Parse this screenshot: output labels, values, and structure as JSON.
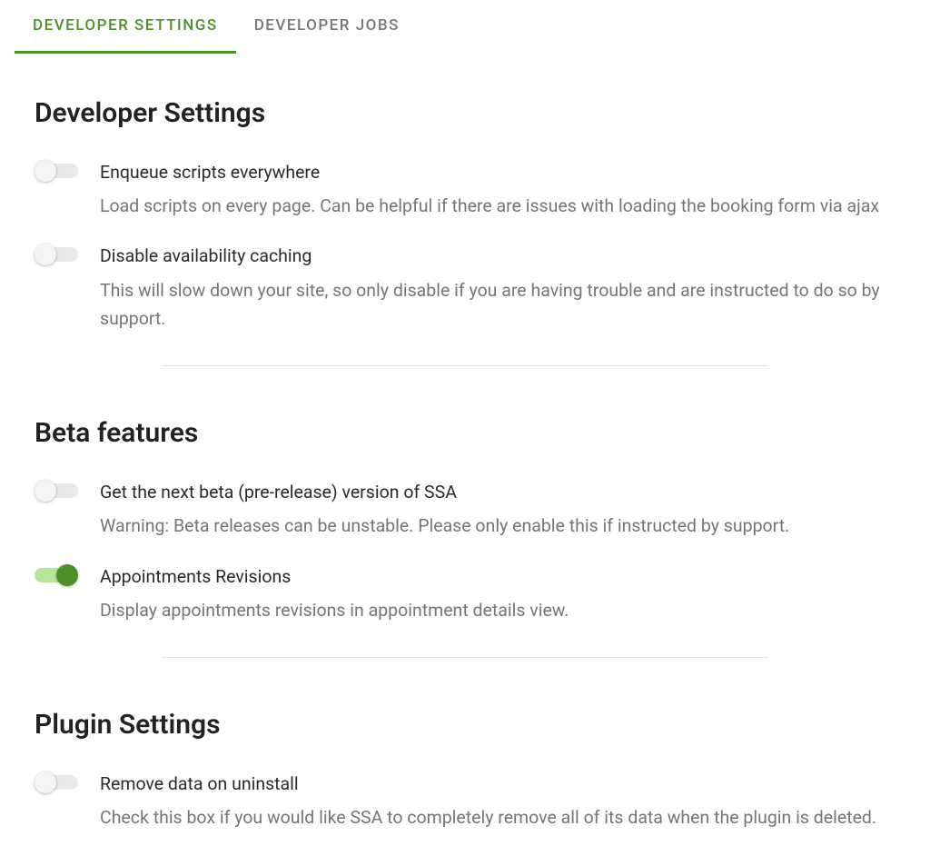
{
  "tabs": [
    {
      "label": "Developer Settings",
      "active": true
    },
    {
      "label": "Developer Jobs",
      "active": false
    }
  ],
  "sections": [
    {
      "heading": "Developer Settings",
      "settings": [
        {
          "title": "Enqueue scripts everywhere",
          "desc": "Load scripts on every page. Can be helpful if there are issues with loading the booking form via ajax",
          "on": false
        },
        {
          "title": "Disable availability caching",
          "desc": "This will slow down your site, so only disable if you are having trouble and are instructed to do so by support.",
          "on": false
        }
      ]
    },
    {
      "heading": "Beta features",
      "settings": [
        {
          "title": "Get the next beta (pre-release) version of SSA",
          "desc": "Warning: Beta releases can be unstable. Please only enable this if instructed by support.",
          "on": false
        },
        {
          "title": "Appointments Revisions",
          "desc": "Display appointments revisions in appointment details view.",
          "on": true
        }
      ]
    },
    {
      "heading": "Plugin Settings",
      "settings": [
        {
          "title": "Remove data on uninstall",
          "desc": "Check this box if you would like SSA to completely remove all of its data when the plugin is deleted.",
          "on": false
        }
      ]
    }
  ]
}
